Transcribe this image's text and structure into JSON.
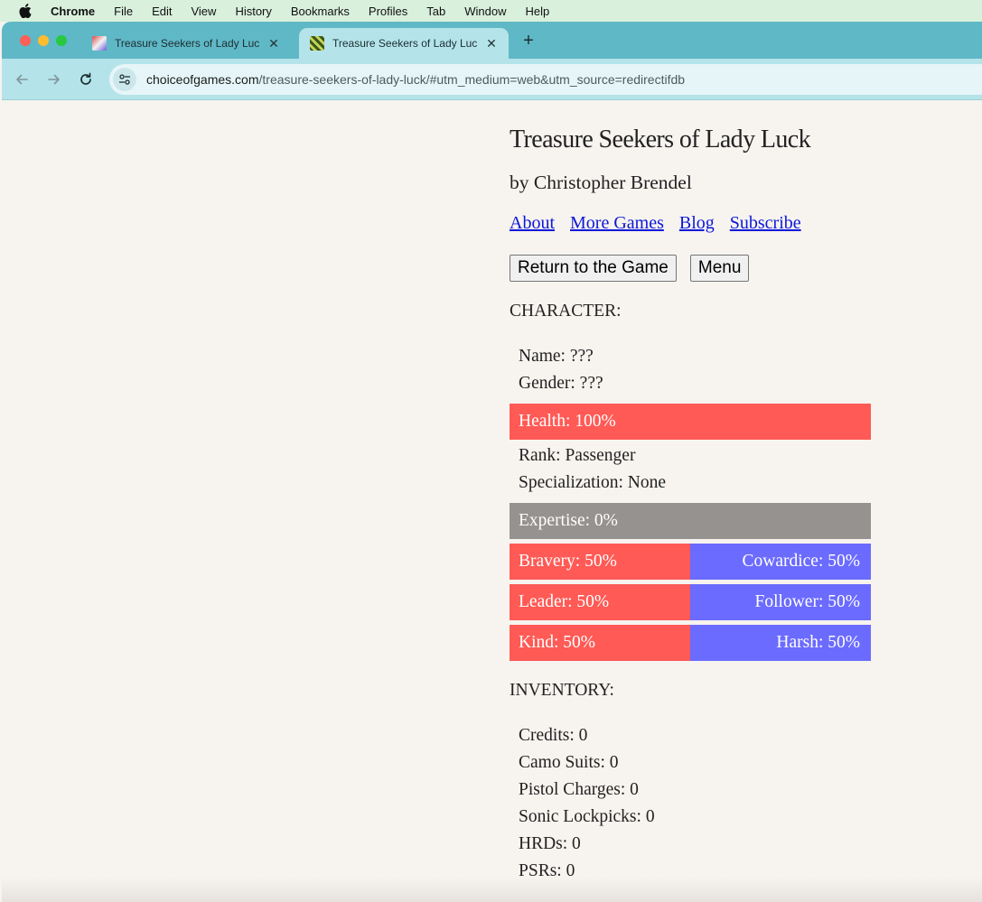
{
  "menubar": {
    "items": [
      "Chrome",
      "File",
      "Edit",
      "View",
      "History",
      "Bookmarks",
      "Profiles",
      "Tab",
      "Window",
      "Help"
    ]
  },
  "browser": {
    "tabs": [
      {
        "title": "Treasure Seekers of Lady Luc",
        "active": false
      },
      {
        "title": "Treasure Seekers of Lady Luc",
        "active": true
      }
    ],
    "url_host": "choiceofgames.com",
    "url_path": "/treasure-seekers-of-lady-luck/#utm_medium=web&utm_source=redirectifdb"
  },
  "page": {
    "title": "Treasure Seekers of Lady Luck",
    "author": "by Christopher Brendel",
    "links": [
      "About",
      "More Games",
      "Blog",
      "Subscribe"
    ],
    "buttons": {
      "return": "Return to the Game",
      "menu": "Menu"
    },
    "character_heading": "CHARACTER:",
    "name": "Name: ???",
    "gender": "Gender: ???",
    "health": {
      "label": "Health: 100%",
      "value": 100
    },
    "rank": "Rank: Passenger",
    "specialization": "Specialization: None",
    "expertise": {
      "label": "Expertise: 0%",
      "value": 0
    },
    "opposed": [
      {
        "left": "Bravery: 50%",
        "right": "Cowardice: 50%",
        "value": 50
      },
      {
        "left": "Leader: 50%",
        "right": "Follower: 50%",
        "value": 50
      },
      {
        "left": "Kind: 50%",
        "right": "Harsh: 50%",
        "value": 50
      }
    ],
    "inventory_heading": "INVENTORY:",
    "inventory": [
      "Credits: 0",
      "Camo Suits: 0",
      "Pistol Charges: 0",
      "Sonic Lockpicks: 0",
      "HRDs: 0",
      "PSRs: 0"
    ]
  },
  "colors": {
    "bar_red": "#ff5a55",
    "bar_blue": "#6b6bff",
    "bar_gray": "#959290",
    "link": "#0b18d8"
  }
}
